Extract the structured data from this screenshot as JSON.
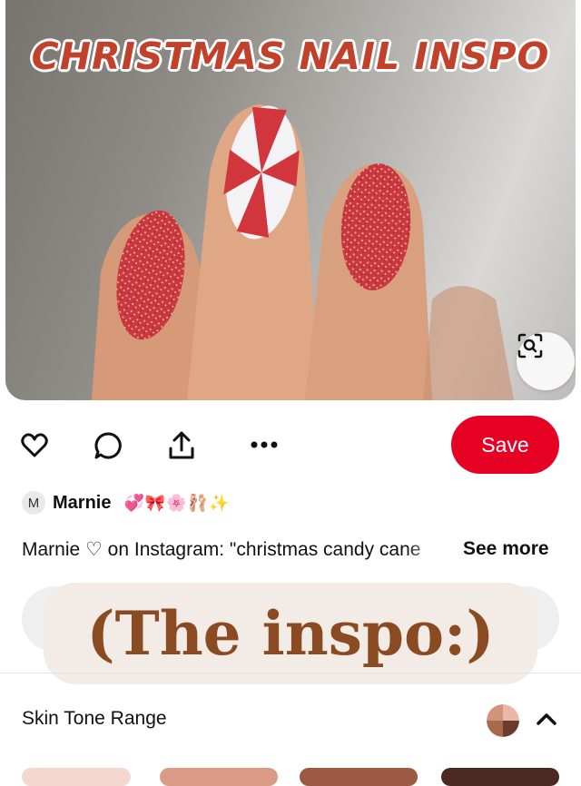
{
  "hero": {
    "title": "CHRISTMAS NAIL INSPO"
  },
  "actions": {
    "save_label": "Save"
  },
  "author": {
    "initial": "M",
    "name": "Marnie",
    "emoji": "💞🎀🌸🩰✨"
  },
  "description": {
    "text": "Marnie ♡ on Instagram: \"christmas candy cane",
    "see_more": "See more"
  },
  "overlay": {
    "text": "(The inspo:)"
  },
  "skin_tone": {
    "label": "Skin Tone Range"
  },
  "colors": {
    "save": "#e60023",
    "title": "#c2412b",
    "sticker_text": "#8a4a22",
    "sticker_bg": "#f3ece6"
  }
}
